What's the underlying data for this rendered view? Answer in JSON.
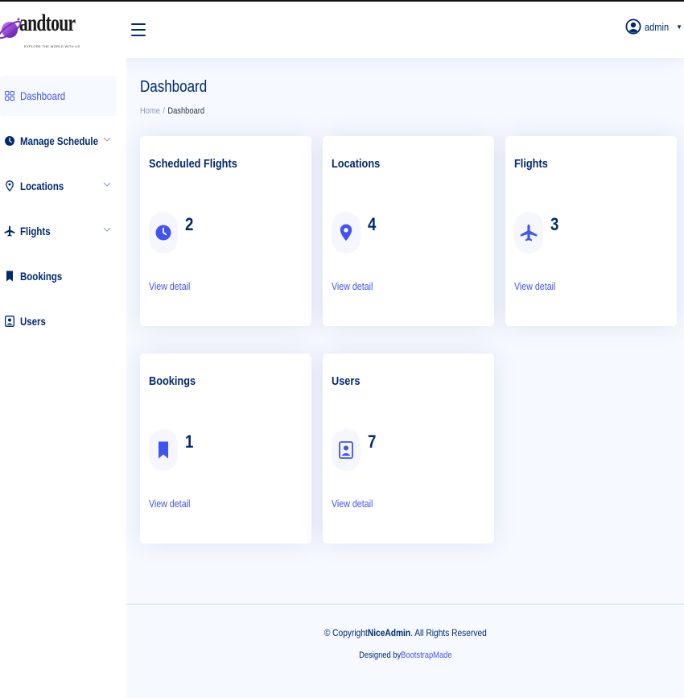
{
  "brand": {
    "name": "andtour",
    "tagline": "EXPLORE THE WORLD WITH US"
  },
  "header": {
    "user_name": "admin"
  },
  "sidebar": {
    "items": [
      {
        "label": "Dashboard",
        "icon": "grid-icon",
        "active": true
      },
      {
        "label": "Manage Schedule",
        "icon": "clock-icon",
        "has_chevron": true
      },
      {
        "label": "Locations",
        "icon": "location-pin-icon",
        "has_chevron": true
      },
      {
        "label": "Flights",
        "icon": "airplane-icon",
        "has_chevron": true
      },
      {
        "label": "Bookings",
        "icon": "bookmark-icon"
      },
      {
        "label": "Users",
        "icon": "person-badge-icon"
      }
    ]
  },
  "page": {
    "title": "Dashboard",
    "breadcrumb": {
      "home": "Home",
      "separator": "/",
      "current": "Dashboard"
    }
  },
  "cards": [
    {
      "title": "Scheduled Flights",
      "value": "2",
      "icon": "clock-icon",
      "link": "View detail"
    },
    {
      "title": "Locations",
      "value": "4",
      "icon": "location-pin-icon",
      "link": "View detail"
    },
    {
      "title": "Flights",
      "value": "3",
      "icon": "airplane-icon",
      "link": "View detail"
    },
    {
      "title": "Bookings",
      "value": "1",
      "icon": "bookmark-icon",
      "link": "View detail"
    },
    {
      "title": "Users",
      "value": "7",
      "icon": "person-badge-icon",
      "link": "View detail"
    }
  ],
  "footer": {
    "copyright_prefix": "© Copyright ",
    "copyright_brand": "NiceAdmin",
    "copyright_suffix": ". All Rights Reserved",
    "designed_by_prefix": "Designed by ",
    "designed_by_link": "BootstrapMade"
  },
  "colors": {
    "primary": "#4154f1",
    "navy": "#012970",
    "background": "#f6f9ff",
    "muted": "#899bbd"
  }
}
